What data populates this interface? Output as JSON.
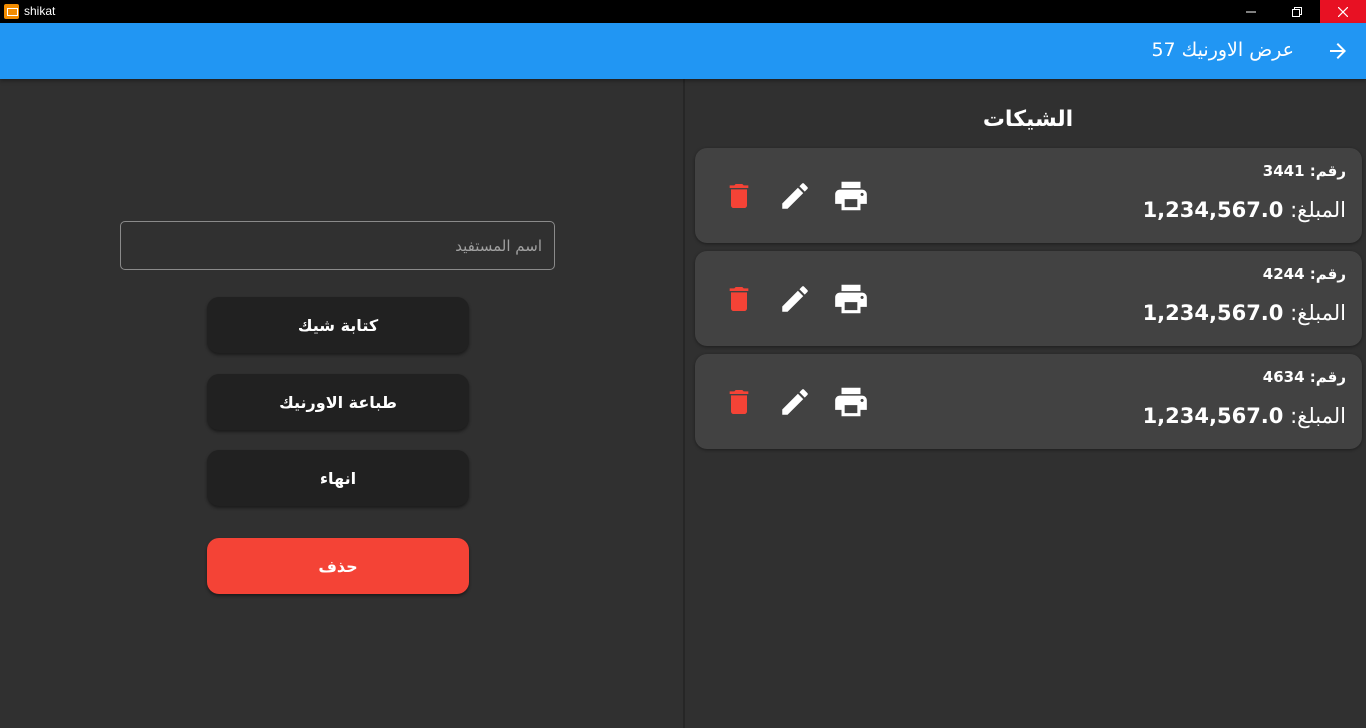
{
  "window": {
    "title": "shikat"
  },
  "appbar": {
    "title": "عرض الاورنيك 57",
    "back_icon": "arrow-forward-icon",
    "color": "#2196f3"
  },
  "form": {
    "beneficiary_placeholder": "اسم المستفيد",
    "beneficiary_value": ""
  },
  "actions": {
    "write_check": "كتابة شيك",
    "print_form": "طباعة الاورنيك",
    "finish": "انهاء",
    "delete": "حذف"
  },
  "checks_section": {
    "title": "الشيكات",
    "number_label": "رقم:",
    "amount_label": "المبلغ:",
    "items": [
      {
        "number": "3441",
        "amount": "1,234,567.0"
      },
      {
        "number": "4244",
        "amount": "1,234,567.0"
      },
      {
        "number": "4634",
        "amount": "1,234,567.0"
      }
    ]
  },
  "colors": {
    "background": "#303030",
    "card": "#424242",
    "button": "#212121",
    "danger": "#f44336"
  },
  "icons": {
    "delete": "trash-icon",
    "edit": "pencil-icon",
    "print": "printer-icon"
  }
}
